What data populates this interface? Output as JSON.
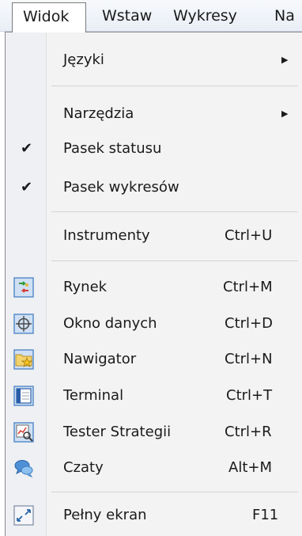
{
  "menubar": {
    "items": [
      {
        "label": "Widok"
      },
      {
        "label": "Wstaw"
      },
      {
        "label": "Wykresy"
      },
      {
        "label": "Na"
      }
    ]
  },
  "menu": {
    "languages": {
      "label": "Języki",
      "icon": "submenu-arrow-icon"
    },
    "tools": {
      "label": "Narzędzia",
      "icon": "submenu-arrow-icon"
    },
    "status_bar": {
      "label": "Pasek statusu",
      "checked": true,
      "icon": "checkmark-icon"
    },
    "charts_bar": {
      "label": "Pasek wykresów",
      "checked": true,
      "icon": "checkmark-icon"
    },
    "instruments": {
      "label": "Instrumenty",
      "shortcut": "Ctrl+U"
    },
    "market": {
      "label": "Rynek",
      "shortcut": "Ctrl+M",
      "icon": "market-watch-icon"
    },
    "data_window": {
      "label": "Okno danych",
      "shortcut": "Ctrl+D",
      "icon": "crosshair-icon"
    },
    "navigator": {
      "label": "Nawigator",
      "shortcut": "Ctrl+N",
      "icon": "navigator-folder-star-icon"
    },
    "terminal": {
      "label": "Terminal",
      "shortcut": "Ctrl+T",
      "icon": "terminal-window-icon"
    },
    "strategy_tester": {
      "label": "Tester Strategii",
      "shortcut": "Ctrl+R",
      "icon": "strategy-tester-icon"
    },
    "chats": {
      "label": "Czaty",
      "shortcut": "Alt+M",
      "icon": "chat-bubbles-icon"
    },
    "full_screen": {
      "label": "Pełny ekran",
      "shortcut": "F11",
      "icon": "fullscreen-arrows-icon"
    }
  },
  "colors": {
    "menubar_bg": "#e9eef6",
    "dropdown_bg": "#f3f3f3",
    "icon_gutter_bg": "#eef0f3",
    "icon_frame": "#5a8ec9",
    "icon_fill": "#cfe0f4"
  }
}
